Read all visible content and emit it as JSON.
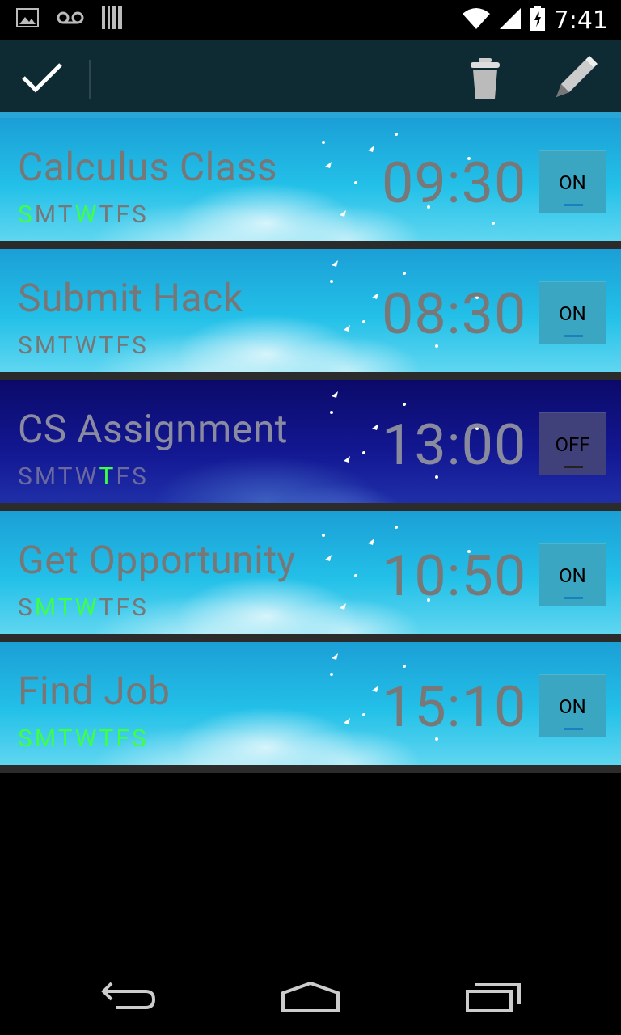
{
  "status_bar": {
    "time": "7:41",
    "icons": [
      "image-icon",
      "voicemail-icon",
      "barcode-icon",
      "wifi-icon",
      "signal-icon",
      "battery-charging-icon"
    ]
  },
  "action_bar": {
    "icons": [
      "check-icon",
      "trash-icon",
      "pencil-icon"
    ]
  },
  "alarms": [
    {
      "name": "Calculus Class",
      "time": "09:30",
      "toggle": "ON",
      "state": "on",
      "days": [
        "S",
        "M",
        "T",
        "W",
        "T",
        "F",
        "S"
      ],
      "active_days": [
        true,
        false,
        false,
        true,
        false,
        false,
        false
      ]
    },
    {
      "name": "Submit Hack",
      "time": "08:30",
      "toggle": "ON",
      "state": "on",
      "days": [
        "S",
        "M",
        "T",
        "W",
        "T",
        "F",
        "S"
      ],
      "active_days": [
        false,
        false,
        false,
        false,
        false,
        false,
        false
      ]
    },
    {
      "name": "CS Assignment",
      "time": "13:00",
      "toggle": "OFF",
      "state": "off",
      "days": [
        "S",
        "M",
        "T",
        "W",
        "T",
        "F",
        "S"
      ],
      "active_days": [
        false,
        false,
        false,
        false,
        true,
        false,
        false
      ]
    },
    {
      "name": "Get Opportunity",
      "time": "10:50",
      "toggle": "ON",
      "state": "on",
      "days": [
        "S",
        "M",
        "T",
        "W",
        "T",
        "F",
        "S"
      ],
      "active_days": [
        false,
        true,
        true,
        true,
        false,
        false,
        false
      ]
    },
    {
      "name": "Find Job",
      "time": "15:10",
      "toggle": "ON",
      "state": "on",
      "days": [
        "S",
        "M",
        "T",
        "W",
        "T",
        "F",
        "S"
      ],
      "active_days": [
        true,
        true,
        true,
        true,
        true,
        true,
        true
      ]
    }
  ],
  "nav_bar": {
    "icons": [
      "back-icon",
      "home-icon",
      "recent-apps-icon"
    ]
  }
}
